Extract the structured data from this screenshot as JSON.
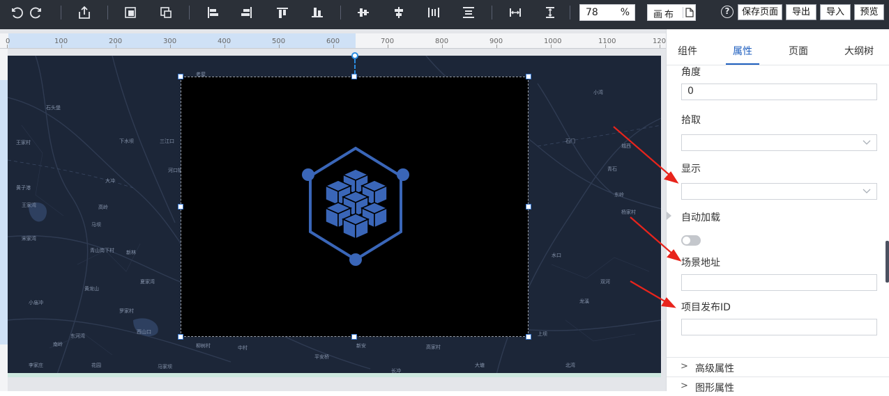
{
  "toolbar": {
    "icons": [
      "undo-icon",
      "redo-icon",
      "export-share-icon",
      "layer-forward-icon",
      "layer-copy-icon",
      "align-left-icon",
      "align-right-icon",
      "align-top-icon",
      "align-bottom-icon",
      "align-vcenter-icon",
      "align-hcenter-icon",
      "distribute-horizontal-icon",
      "distribute-vertical-icon",
      "same-width-icon",
      "same-height-icon"
    ],
    "zoom_value": "78",
    "zoom_unit": "%",
    "canvas_label": "画布",
    "save_label": "保存页面",
    "export_label": "导出",
    "import_label": "导入",
    "preview_label": "预览"
  },
  "ruler": {
    "labels": [
      "0",
      "100",
      "200",
      "300",
      "400",
      "500",
      "600",
      "700",
      "800",
      "900",
      "1000",
      "1100",
      "120"
    ]
  },
  "map": {
    "labels": [
      "石头堡",
      "王家村",
      "黄子港",
      "王家湾",
      "宋家湾",
      "下水坝",
      "三江口",
      "河口镇",
      "大冲",
      "高岭",
      "马坝",
      "青山岗下村",
      "新林",
      "夏家湾",
      "小庙冲",
      "黄龙山",
      "罗家村",
      "西山口",
      "东河湾",
      "南岭",
      "李家庄",
      "花园",
      "马家坝",
      "柳树村",
      "中村",
      "平安桥",
      "新安",
      "长冲",
      "高家村",
      "大塘",
      "上坝",
      "北湾",
      "水口",
      "龙溪",
      "双河",
      "东岭",
      "城西",
      "石门",
      "小湾",
      "青石",
      "杨家村",
      "老屋"
    ],
    "component_icon": "cube-hexagon-icon"
  },
  "panel": {
    "tabs": [
      "组件",
      "属性",
      "页面",
      "大纲树"
    ],
    "active_tab": "属性",
    "angle_label": "角度",
    "angle_value": "0",
    "pick_label": "拾取",
    "pick_value": "",
    "display_label": "显示",
    "display_value": "",
    "autoload_label": "自动加载",
    "autoload_on": false,
    "scene_url_label": "场景地址",
    "scene_url_value": "",
    "project_id_label": "项目发布ID",
    "project_id_value": "",
    "advanced_label": "高级属性",
    "graphic_label": "图形属性"
  },
  "colors": {
    "accent": "#1f5fbf",
    "toolbar_bg": "#2b3038",
    "map_bg": "#1c2638",
    "icon_blue": "#3a66b8",
    "arrow_red": "#e8241c"
  }
}
